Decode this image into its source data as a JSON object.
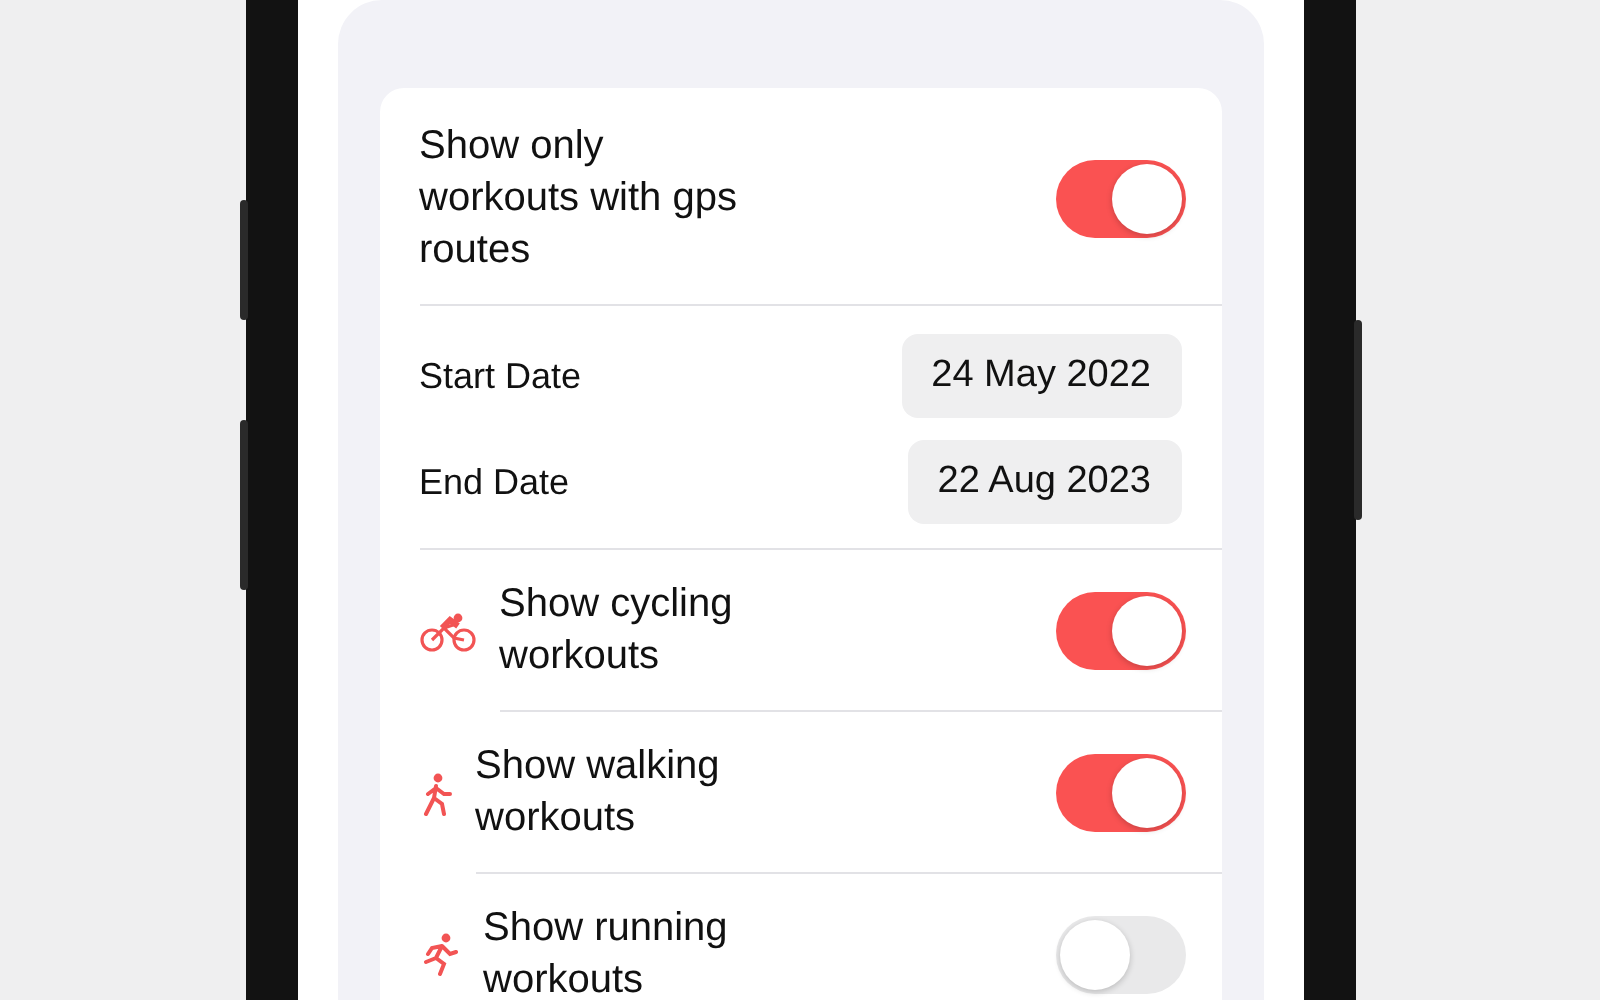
{
  "settings_card": {
    "gps_filter": {
      "label": "Show only workouts with gps routes",
      "on": true
    },
    "date_rows": [
      {
        "label": "Start Date",
        "value": "24 May 2022"
      },
      {
        "label": "End Date",
        "value": "22 Aug 2023"
      }
    ],
    "activity_toggles": [
      {
        "kind": "cycling",
        "label": "Show cycling workouts",
        "on": true
      },
      {
        "kind": "walking",
        "label": "Show walking workouts",
        "on": true
      },
      {
        "kind": "running",
        "label": "Show running workouts",
        "on": false
      }
    ]
  }
}
